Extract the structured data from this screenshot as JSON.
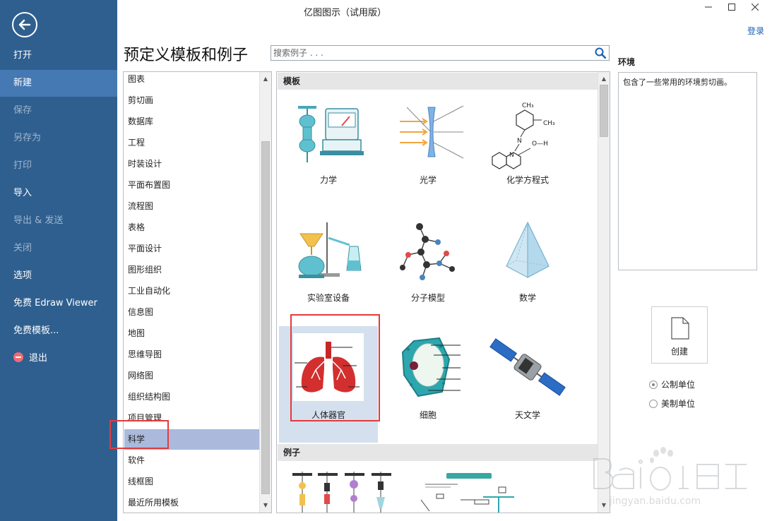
{
  "window": {
    "title": "亿图图示（试用版）",
    "login": "登录"
  },
  "sidebar": {
    "items": [
      {
        "label": "打开",
        "state": "normal"
      },
      {
        "label": "新建",
        "state": "active"
      },
      {
        "label": "保存",
        "state": "disabled"
      },
      {
        "label": "另存为",
        "state": "disabled"
      },
      {
        "label": "打印",
        "state": "disabled"
      },
      {
        "label": "导入",
        "state": "normal"
      },
      {
        "label": "导出 & 发送",
        "state": "disabled"
      },
      {
        "label": "关闭",
        "state": "disabled"
      },
      {
        "label": "选项",
        "state": "normal"
      },
      {
        "label": "免费 Edraw Viewer",
        "state": "normal"
      },
      {
        "label": "免费模板...",
        "state": "normal"
      },
      {
        "label": "退出",
        "state": "normal"
      }
    ]
  },
  "main": {
    "heading": "预定义模板和例子",
    "search_placeholder": "搜索例子 . . ."
  },
  "categories": [
    "图表",
    "剪切画",
    "数据库",
    "工程",
    "时装设计",
    "平面布置图",
    "流程图",
    "表格",
    "平面设计",
    "图形组织",
    "工业自动化",
    "信息图",
    "地图",
    "思维导图",
    "网络图",
    "组织结构图",
    "项目管理",
    "科学",
    "软件",
    "线框图",
    "最近所用模板"
  ],
  "selected_category": "科学",
  "gallery": {
    "templates_header": "模板",
    "examples_header": "例子",
    "templates": [
      {
        "label": "力学",
        "icon": "mechanics-icon"
      },
      {
        "label": "光学",
        "icon": "optics-icon"
      },
      {
        "label": "化学方程式",
        "icon": "chemical-formula-icon"
      },
      {
        "label": "实验室设备",
        "icon": "lab-equipment-icon"
      },
      {
        "label": "分子模型",
        "icon": "molecule-icon"
      },
      {
        "label": "数学",
        "icon": "pyramid-icon"
      },
      {
        "label": "人体器官",
        "icon": "lungs-icon"
      },
      {
        "label": "细胞",
        "icon": "cell-icon"
      },
      {
        "label": "天文学",
        "icon": "satellite-icon"
      }
    ],
    "selected_template": "人体器官",
    "molecule_labels": {
      "ch3": "CH₃",
      "oh": "O—H",
      "n": "N"
    }
  },
  "preview": {
    "title": "环境",
    "description": "包含了一些常用的环境剪切画。",
    "create_label": "创建",
    "units": [
      {
        "label": "公制单位",
        "checked": true
      },
      {
        "label": "美制单位",
        "checked": false
      }
    ]
  },
  "colors": {
    "sidebar": "#2f5f8f",
    "sidebar_active": "#4479b3",
    "selection": "#aab9dc",
    "highlight": "#e23b3b",
    "teal": "#2ea6ae"
  }
}
